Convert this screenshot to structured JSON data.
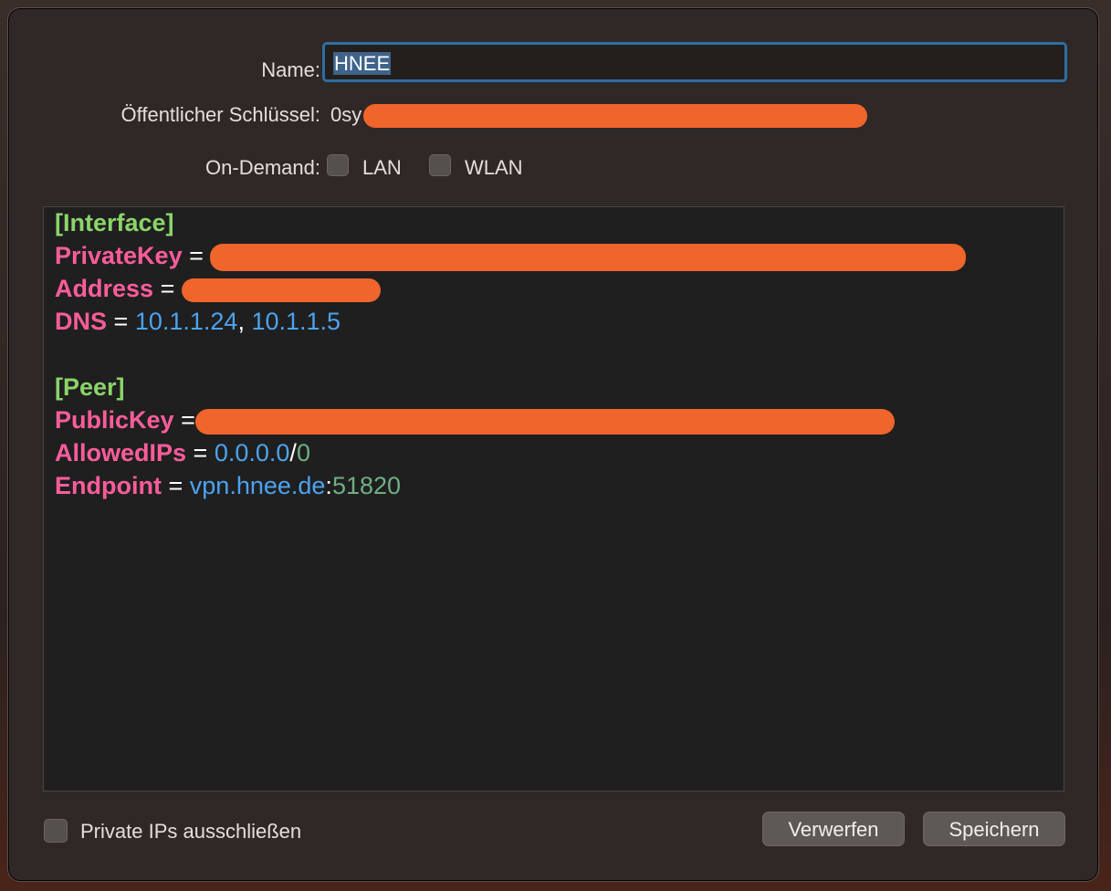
{
  "form": {
    "name_label": "Name:",
    "name_value": "HNEE",
    "pubkey_label": "Öffentlicher Schlüssel:",
    "pubkey_visible_prefix": "0sy",
    "ondemand_label": "On-Demand:",
    "ondemand_options": [
      {
        "label": "LAN",
        "checked": false
      },
      {
        "label": "WLAN",
        "checked": false
      }
    ]
  },
  "config": {
    "interface_header": "[Interface]",
    "privatekey_key": "PrivateKey",
    "address_key": "Address",
    "dns_key": "DNS",
    "dns_value_1": "10.1.1.24",
    "dns_separator": ",",
    "dns_value_2": "10.1.1.5",
    "peer_header": "[Peer]",
    "publickey_key": "PublicKey",
    "allowedips_key": "AllowedIPs",
    "allowedips_ip": "0.0.0.0",
    "allowedips_slash": "/",
    "allowedips_mask": "0",
    "endpoint_key": "Endpoint",
    "endpoint_host": "vpn.hnee.de",
    "endpoint_colon": ":",
    "endpoint_port": "51820",
    "equals": "="
  },
  "footer": {
    "exclude_private_label": "Private IPs ausschließen",
    "exclude_private_checked": false,
    "discard_button": "Verwerfen",
    "save_button": "Speichern"
  },
  "colors": {
    "redaction": "#f0652b",
    "focus_ring": "#2d6ea3",
    "section": "#8bd46a",
    "key": "#ff5d9b",
    "value": "#4ca3f0",
    "number": "#6fae84"
  }
}
